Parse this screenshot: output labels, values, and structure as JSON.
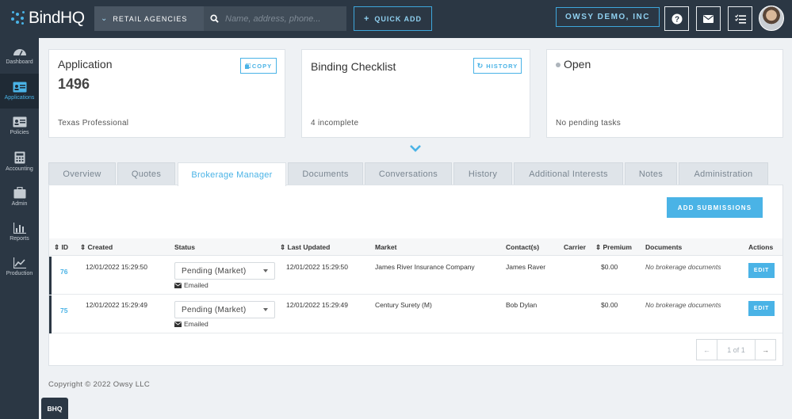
{
  "app": {
    "logo_text": "BindHQ",
    "accent": "#4ab3e6",
    "nav_bg": "#2b3744"
  },
  "topbar": {
    "agency_label": "RETAIL AGENCIES",
    "search_placeholder": "Name, address, phone...",
    "quick_add_label": "QUICK ADD",
    "account_label": "OWSY DEMO, INC",
    "icons": [
      "help-icon",
      "mail-icon",
      "tasks-icon"
    ]
  },
  "sidebar": {
    "items": [
      {
        "label": "Dashboard",
        "icon": "dashboard-icon"
      },
      {
        "label": "Applications",
        "icon": "applications-icon",
        "active": true
      },
      {
        "label": "Policies",
        "icon": "policies-icon"
      },
      {
        "label": "Accounting",
        "icon": "calculator-icon"
      },
      {
        "label": "Admin",
        "icon": "briefcase-icon"
      },
      {
        "label": "Reports",
        "icon": "bar-chart-icon"
      },
      {
        "label": "Production",
        "icon": "line-chart-icon"
      }
    ]
  },
  "cards": {
    "application": {
      "title": "Application",
      "number": "1496",
      "copy_label": "COPY",
      "footer": "Texas Professional"
    },
    "checklist": {
      "title": "Binding Checklist",
      "history_label": "HISTORY",
      "footer": "4 incomplete"
    },
    "status": {
      "title": "Open",
      "footer": "No pending tasks"
    }
  },
  "tabs": [
    {
      "label": "Overview"
    },
    {
      "label": "Quotes"
    },
    {
      "label": "Brokerage Manager",
      "active": true
    },
    {
      "label": "Documents"
    },
    {
      "label": "Conversations"
    },
    {
      "label": "History"
    },
    {
      "label": "Additional Interests"
    },
    {
      "label": "Notes"
    },
    {
      "label": "Administration"
    }
  ],
  "brokerage": {
    "add_submissions_label": "ADD SUBMISSIONS",
    "columns": {
      "id": "ID",
      "created": "Created",
      "status": "Status",
      "last_updated": "Last Updated",
      "market": "Market",
      "contacts": "Contact(s)",
      "carrier": "Carrier",
      "premium": "Premium",
      "documents": "Documents",
      "actions": "Actions"
    },
    "rows": [
      {
        "id": "76",
        "created": "12/01/2022 15:29:50",
        "status": "Pending (Market)",
        "emailed": "Emailed",
        "last_updated": "12/01/2022 15:29:50",
        "market": "James River Insurance Company",
        "contacts": "James Raver",
        "carrier": "",
        "premium": "$0.00",
        "documents": "No brokerage documents",
        "action": "EDIT"
      },
      {
        "id": "75",
        "created": "12/01/2022 15:29:49",
        "status": "Pending (Market)",
        "emailed": "Emailed",
        "last_updated": "12/01/2022 15:29:49",
        "market": "Century Surety (M)",
        "contacts": "Bob Dylan",
        "carrier": "",
        "premium": "$0.00",
        "documents": "No brokerage documents",
        "action": "EDIT"
      }
    ],
    "pagination": {
      "text": "1 of 1",
      "prev_icon": "arrow-left-icon",
      "next_icon": "arrow-right-icon"
    }
  },
  "footer": {
    "copyright": "Copyright © 2022 Owsy LLC",
    "bhq_tab": "BHQ"
  }
}
